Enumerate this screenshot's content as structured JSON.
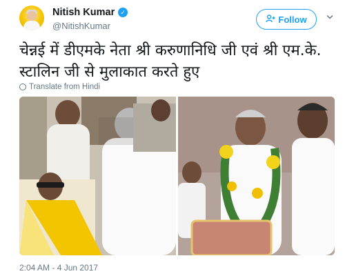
{
  "user": {
    "display_name": "Nitish Kumar",
    "handle": "@NitishKumar",
    "verified": true
  },
  "actions": {
    "follow_label": "Follow",
    "follow_icon": "add-person-icon"
  },
  "tweet": {
    "text": "चेन्नई में डीएमके नेता श्री करुणानिधि जी एवं श्री एम.के. स्टालिन जी से मुलाकात करते हुए",
    "translate_label": "Translate from Hindi",
    "timestamp": "2:04 AM - 4 Jun 2017"
  },
  "colors": {
    "brand": "#1da1f2",
    "secondary_text": "#657786",
    "primary_text": "#14171a"
  }
}
